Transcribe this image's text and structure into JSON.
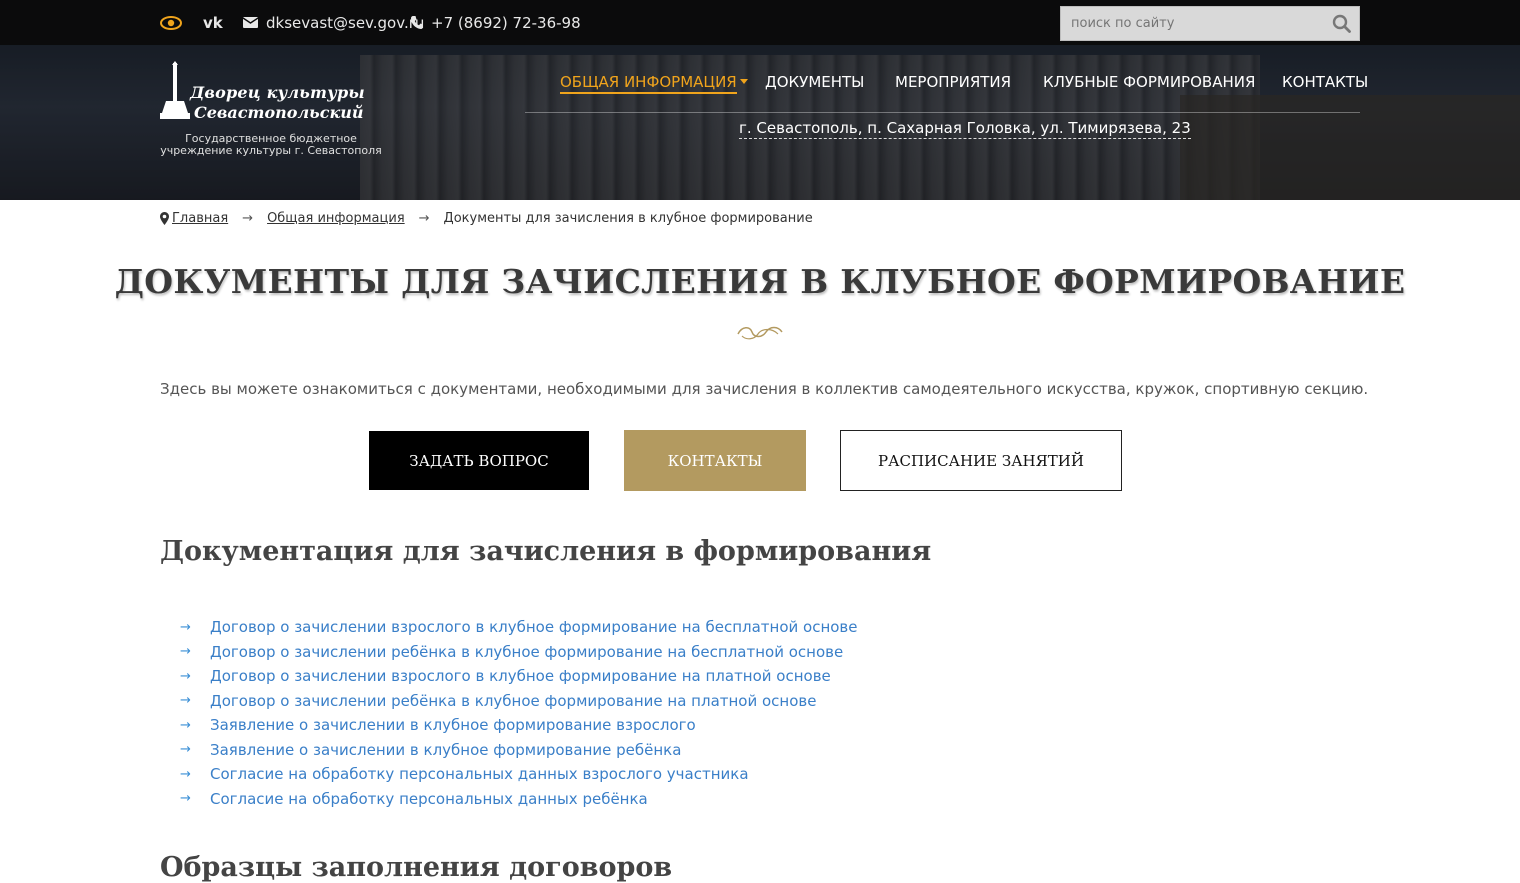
{
  "topbar": {
    "email": "dksevast@sev.gov.ru",
    "phone": "+7 (8692) 72-36-98",
    "search_placeholder": "поиск по сайту",
    "accent_color": "#f0a41c"
  },
  "logo": {
    "line1": "Дворец культуры",
    "line2": "Севастопольский",
    "subtitle": "Государственное бюджетное учреждение культуры г. Севастополя"
  },
  "nav": {
    "items": [
      {
        "label": "ОБЩАЯ ИНФОРМАЦИЯ",
        "active": true
      },
      {
        "label": "ДОКУМЕНТЫ"
      },
      {
        "label": "МЕРОПРИЯТИЯ"
      },
      {
        "label": "КЛУБНЫЕ ФОРМИРОВАНИЯ"
      },
      {
        "label": "КОНТАКТЫ"
      }
    ],
    "address": "г. Севастополь, п. Сахарная Головка, ул. Тимирязева, 23"
  },
  "breadcrumb": {
    "home": "Главная",
    "section": "Общая информация",
    "current": "Документы для зачисления в клубное формирование"
  },
  "page": {
    "title": "ДОКУМЕНТЫ ДЛЯ ЗАЧИСЛЕНИЯ В КЛУБНОЕ ФОРМИРОВАНИЕ",
    "intro": "Здесь вы можете ознакомиться с документами, необходимыми для зачисления в коллектив самодеятельного искусства, кружок, спортивную секцию."
  },
  "buttons": {
    "ask": "ЗАДАТЬ ВОПРОС",
    "contacts": "КОНТАКТЫ",
    "schedule": "РАСПИСАНИЕ ЗАНЯТИЙ",
    "contacts_color": "#b39a60"
  },
  "sections": {
    "docs_title": "Документация для зачисления в формирования",
    "samples_title": "Образцы заполнения договоров"
  },
  "documents": [
    "Договор о зачислении взрослого в клубное формирование на бесплатной основе",
    "Договор о зачислении ребёнка в клубное формирование на бесплатной основе",
    "Договор о зачислении взрослого в клубное формирование на платной основе",
    "Договор о зачислении ребёнка в клубное формирование на платной основе",
    "Заявление о зачислении в клубное формирование взрослого",
    "Заявление о зачислении в клубное формирование ребёнка",
    "Согласие на обработку персональных данных взрослого участника",
    "Согласие на обработку персональных данных ребёнка"
  ],
  "icons": [
    "eye-icon",
    "vk-icon",
    "mail-icon",
    "phone-icon",
    "search-icon",
    "map-pin-icon",
    "ornament-icon"
  ]
}
